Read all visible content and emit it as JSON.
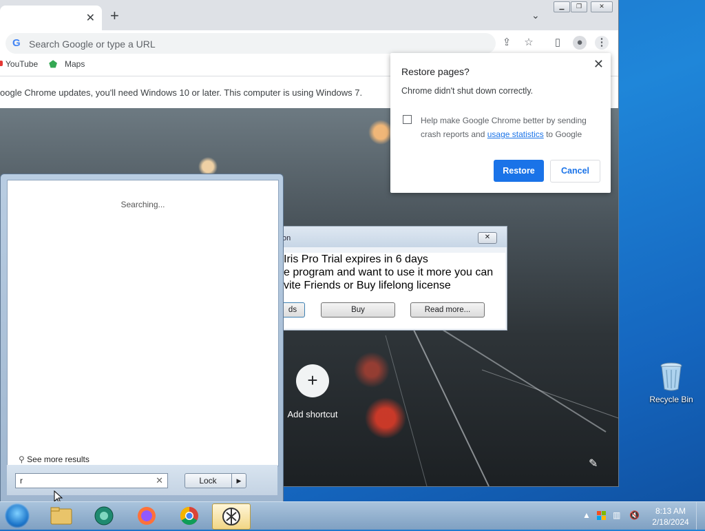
{
  "desktop": {
    "recycle_bin_label": "Recycle Bin"
  },
  "chrome": {
    "omnibox_placeholder": "Search Google or type a URL",
    "bookmarks": [
      "YouTube",
      "Maps"
    ],
    "infobar_text": "oogle Chrome updates, you'll need Windows 10 or later. This computer is using Windows 7.",
    "add_shortcut_label": "Add shortcut",
    "restore_dialog": {
      "title": "Restore pages?",
      "message": "Chrome didn't shut down correctly.",
      "checkbox_text_pre": "Help make Google Chrome better by sending crash reports and ",
      "checkbox_link": "usage statistics",
      "checkbox_text_post": " to Google",
      "restore_button": "Restore",
      "cancel_button": "Cancel"
    }
  },
  "iris_dialog": {
    "title_fragment": "on",
    "line1": "Iris Pro Trial expires in 6 days",
    "line2": "e program and want to use it more you can",
    "line3": "vite Friends or Buy lifelong license",
    "button1": "ds",
    "button2": "Buy",
    "button3": "Read more..."
  },
  "start_menu": {
    "status": "Searching...",
    "see_more": "See more results",
    "search_value": "r",
    "lock_button": "Lock"
  },
  "taskbar": {
    "time": "8:13 AM",
    "date": "2/18/2024"
  }
}
